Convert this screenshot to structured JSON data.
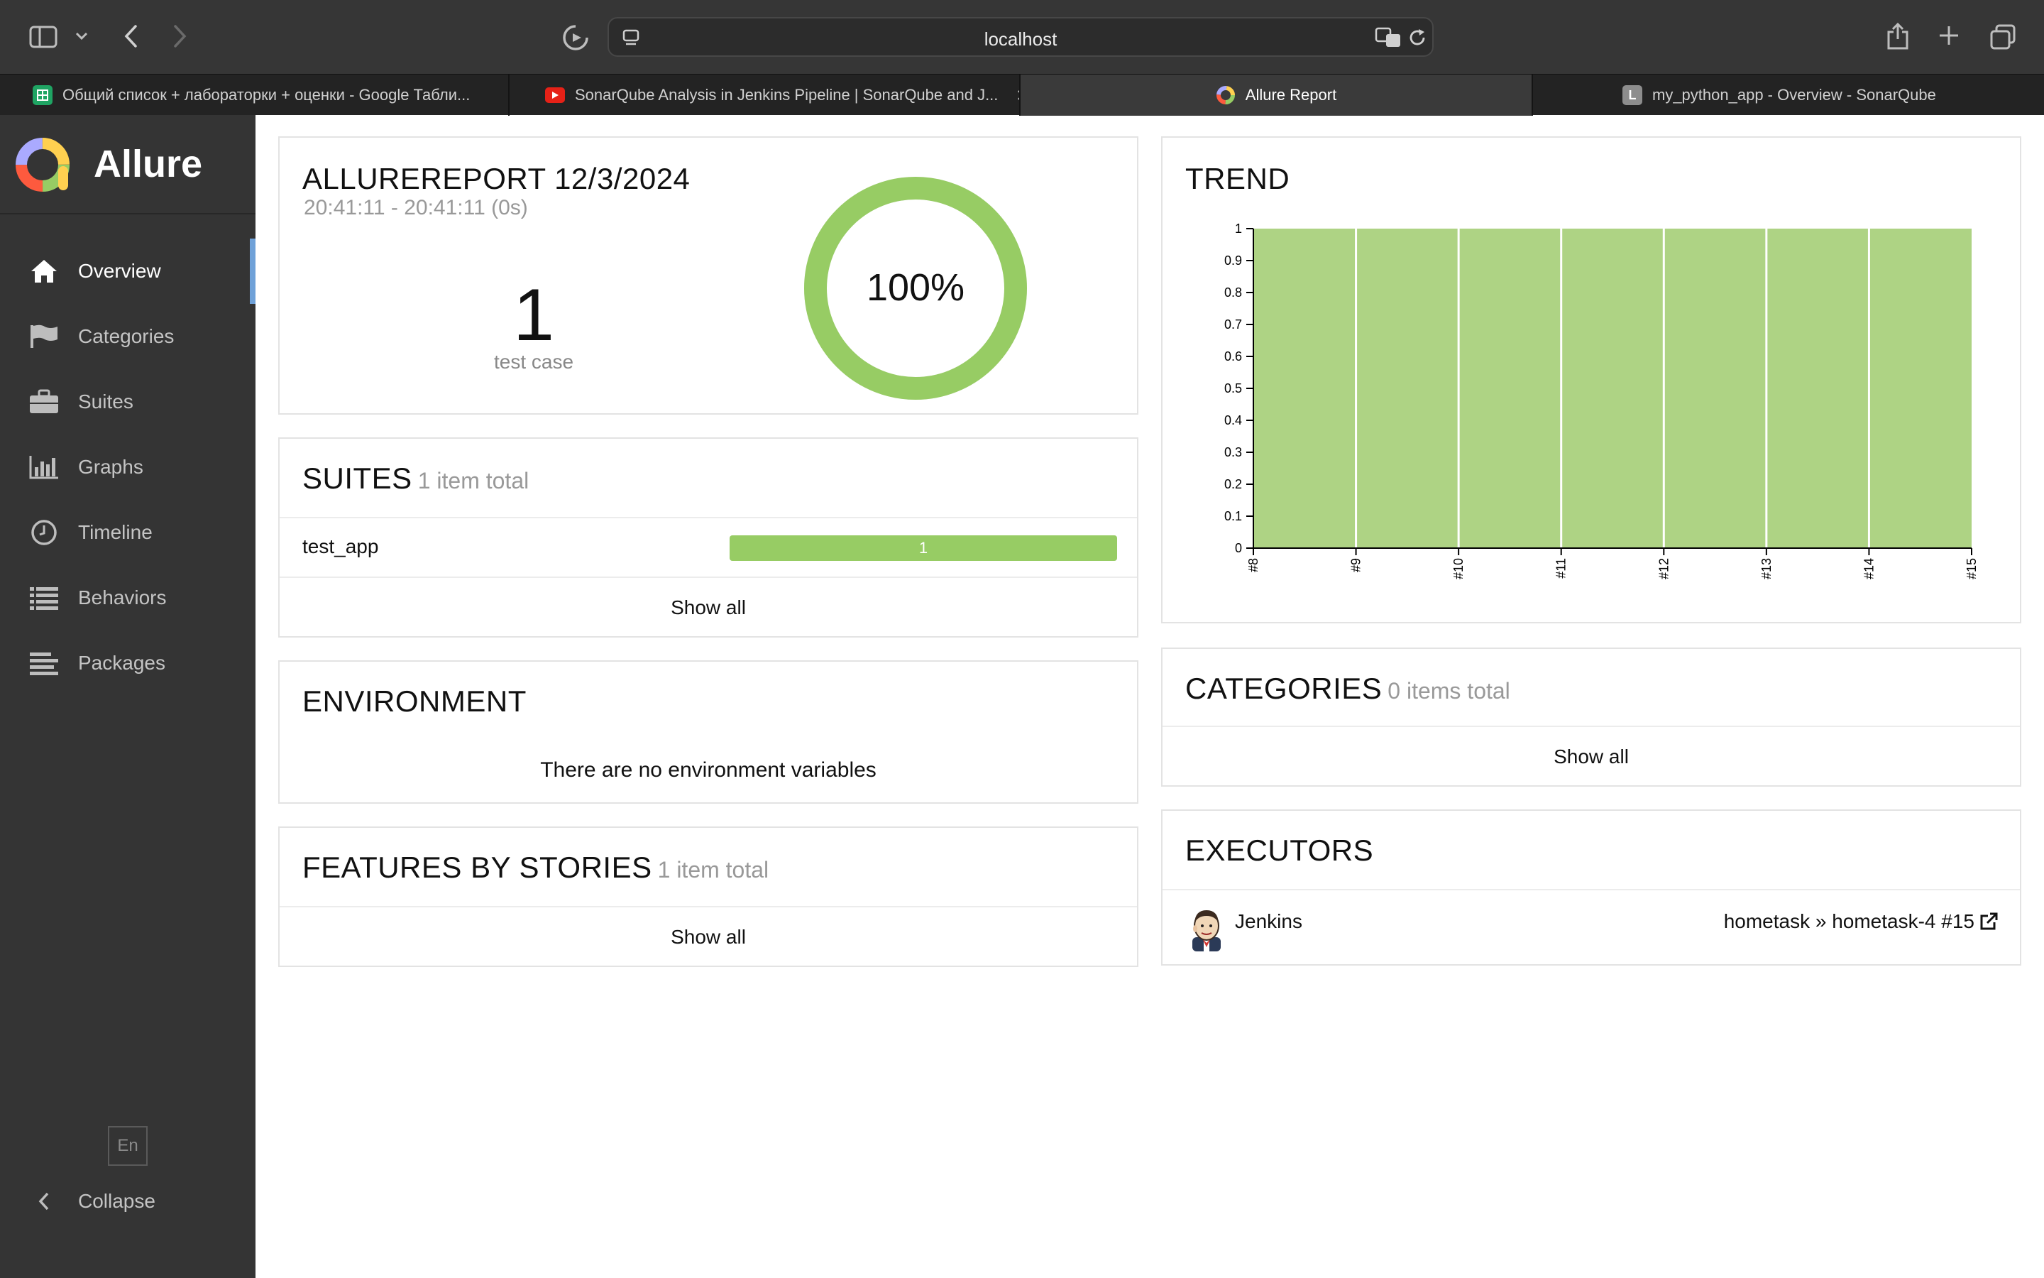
{
  "browser": {
    "url": "localhost",
    "tabs": [
      {
        "title": "Общий список + лабораторки + оценки - Google Табли...",
        "favicon": "sheets-icon"
      },
      {
        "title": "SonarQube Analysis in Jenkins Pipeline | SonarQube and J...",
        "favicon": "youtube-icon"
      },
      {
        "title": "Allure Report",
        "favicon": "allure-icon",
        "active": true
      },
      {
        "title": "my_python_app - Overview - SonarQube",
        "favicon": "letter-l-icon",
        "favicon_letter": "L"
      }
    ]
  },
  "sidebar": {
    "brand": "Allure",
    "items": [
      {
        "label": "Overview",
        "icon": "home-icon",
        "active": true
      },
      {
        "label": "Categories",
        "icon": "flag-icon"
      },
      {
        "label": "Suites",
        "icon": "briefcase-icon"
      },
      {
        "label": "Graphs",
        "icon": "bar-chart-icon"
      },
      {
        "label": "Timeline",
        "icon": "clock-icon"
      },
      {
        "label": "Behaviors",
        "icon": "list-icon"
      },
      {
        "label": "Packages",
        "icon": "align-left-icon"
      }
    ],
    "language": "En",
    "collapse_label": "Collapse"
  },
  "summary": {
    "title": "ALLUREREPORT 12/3/2024",
    "time_range": "20:41:11 - 20:41:11 (0s)",
    "test_count": "1",
    "test_count_label": "test case",
    "pass_percent": "100%",
    "pass_fraction": 1.0
  },
  "suites": {
    "title": "SUITES",
    "count_label": "1 item total",
    "rows": [
      {
        "name": "test_app",
        "passed": "1"
      }
    ],
    "show_all": "Show all"
  },
  "environment": {
    "title": "ENVIRONMENT",
    "empty_text": "There are no environment variables"
  },
  "features": {
    "title": "FEATURES BY STORIES",
    "count_label": "1 item total",
    "show_all": "Show all"
  },
  "trend": {
    "title": "TREND"
  },
  "categories": {
    "title": "CATEGORIES",
    "count_label": "0 items total",
    "show_all": "Show all"
  },
  "executors": {
    "title": "EXECUTORS",
    "name": "Jenkins",
    "build": "hometask » hometask-4 #15",
    "avatar": "jenkins-avatar",
    "link_icon": "external-link-icon"
  },
  "colors": {
    "passed": "#97cc64",
    "trend_fill": "#aed384",
    "sidebar_bg": "#343434",
    "accent": "#6fa1d8"
  },
  "chart_data": {
    "type": "area",
    "x": [
      "#8",
      "#9",
      "#10",
      "#11",
      "#12",
      "#13",
      "#14",
      "#15"
    ],
    "series": [
      {
        "values": [
          1,
          1,
          1,
          1,
          1,
          1,
          1,
          1
        ]
      }
    ],
    "ylim": [
      0,
      1
    ],
    "yticks": [
      "0",
      "0.1",
      "0.2",
      "0.3",
      "0.4",
      "0.5",
      "0.6",
      "0.7",
      "0.8",
      "0.9",
      "1"
    ],
    "grid": false
  }
}
